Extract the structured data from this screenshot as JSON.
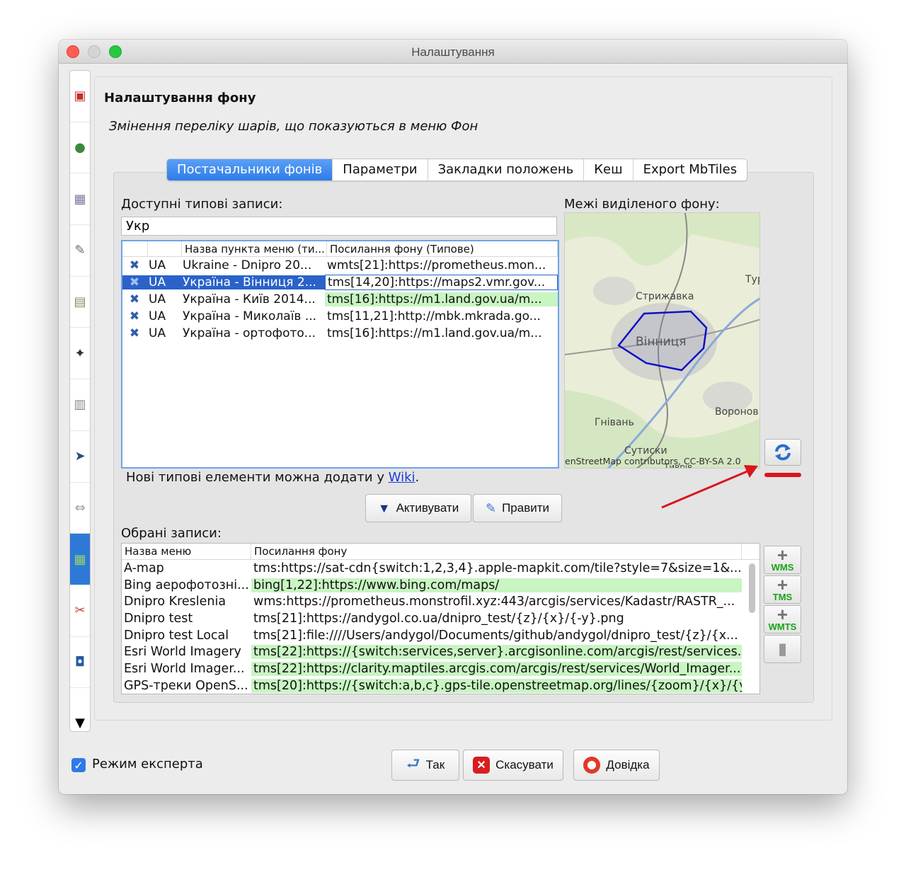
{
  "window": {
    "title": "Налаштування"
  },
  "header": {
    "title": "Налаштування фону",
    "subtitle": "Змінення переліку шарів, що показуються в меню Фон"
  },
  "tabs": [
    {
      "label": "Постачальники фонів",
      "active": true
    },
    {
      "label": "Параметри",
      "active": false
    },
    {
      "label": "Закладки положень",
      "active": false
    },
    {
      "label": "Кеш",
      "active": false
    },
    {
      "label": "Export MbTiles",
      "active": false
    }
  ],
  "available": {
    "label": "Доступні типові записи:",
    "search_value": "Укр",
    "columns": [
      "",
      "",
      "Назва пункта меню (ти...",
      "Посилання фону (Типове)"
    ],
    "rows": [
      {
        "country": "UA",
        "name": "Ukraine - Dnipro 20...",
        "url": "wmts[21]:https://prometheus.mon...",
        "selected": false,
        "green": false
      },
      {
        "country": "UA",
        "name": "Україна - Вінниця 2...",
        "url": "tms[14,20]:https://maps2.vmr.gov...",
        "selected": true,
        "green": false
      },
      {
        "country": "UA",
        "name": "Україна - Київ 2014...",
        "url": "tms[16]:https://m1.land.gov.ua/m...",
        "selected": false,
        "green": true
      },
      {
        "country": "UA",
        "name": "Україна - Миколаїв ...",
        "url": "tms[11,21]:http://mbk.mkrada.go...",
        "selected": false,
        "green": false
      },
      {
        "country": "UA",
        "name": "Україна - ортофото...",
        "url": "tms[16]:https://m1.land.gov.ua/m...",
        "selected": false,
        "green": false
      }
    ],
    "wiki_text": "Нові типові елементи можна додати у",
    "wiki_link": "Wiki",
    "wiki_dot": "."
  },
  "map": {
    "label": "Межі виділеного фону:",
    "places": {
      "stryzhavka": "Стрижавка",
      "vinnytsia": "Вінниця",
      "tur": "Тур",
      "voronov": "Воронов",
      "hnivan": "Гнівань",
      "sutysky": "Сутиски",
      "tyvriv": "Тиврів"
    },
    "attribution": "enStreetMap contributors, CC-BY-SA 2.0"
  },
  "buttons": {
    "activate": "Активувати",
    "edit": "Правити",
    "ok": "Так",
    "cancel": "Скасувати",
    "help": "Довідка"
  },
  "selected": {
    "label": "Обрані записи:",
    "columns": [
      "Назва меню",
      "Посилання фону"
    ],
    "rows": [
      {
        "name": "A-map",
        "url": "tms:https://sat-cdn{switch:1,2,3,4}.apple-mapkit.com/tile?style=7&size=1&...",
        "green": false
      },
      {
        "name": "Bing аерофотозні...",
        "url": "bing[1,22]:https://www.bing.com/maps/",
        "green": true
      },
      {
        "name": "Dnipro Kreslenia",
        "url": "wms:https://prometheus.monstrofil.xyz:443/arcgis/services/Kadastr/RASTR_...",
        "green": false
      },
      {
        "name": "Dnipro test",
        "url": "tms[21]:https://andygol.co.ua/dnipro_test/{z}/{x}/{-y}.png",
        "green": false
      },
      {
        "name": "Dnipro test Local",
        "url": "tms[21]:file:////Users/andygol/Documents/github/andygol/dnipro_test/{z}/{x...",
        "green": false
      },
      {
        "name": "Esri World Imagery",
        "url": "tms[22]:https://{switch:services,server}.arcgisonline.com/arcgis/rest/services...",
        "green": true
      },
      {
        "name": "Esri World Imager...",
        "url": "tms[22]:https://clarity.maptiles.arcgis.com/arcgis/rest/services/World_Imager...",
        "green": true
      },
      {
        "name": "GPS-треки OpenS...",
        "url": "tms[20]:https://{switch:a,b,c}.gps-tile.openstreetmap.org/lines/{zoom}/{x}/{y...",
        "green": true
      }
    ],
    "side_buttons": [
      "WMS",
      "TMS",
      "WMTS"
    ]
  },
  "footer": {
    "expert_mode_label": "Режим експерта",
    "expert_mode_checked": true
  },
  "colors": {
    "selection": "#2a62c9",
    "green_row": "#c8f5c2",
    "tab_active": "#2e7ce8",
    "annotation_red": "#d8161d",
    "bounds_outline": "#1010c8"
  }
}
